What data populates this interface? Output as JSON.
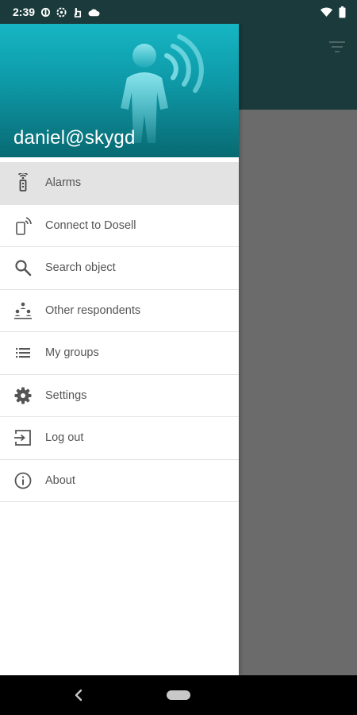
{
  "status_bar": {
    "time": "2:39",
    "left_icons": [
      "sync-icon",
      "settings-badge-icon",
      "touch-icon",
      "cloud-icon"
    ],
    "right_icons": [
      "wifi-icon",
      "battery-icon"
    ]
  },
  "drawer": {
    "account": "daniel@skygd",
    "items": [
      {
        "label": "Alarms",
        "icon": "alarm-icon",
        "active": true
      },
      {
        "label": "Connect to Dosell",
        "icon": "phone-connect-icon"
      },
      {
        "label": "Search object",
        "icon": "search-icon"
      },
      {
        "label": "Other respondents",
        "icon": "respondents-icon"
      },
      {
        "label": "My groups",
        "icon": "list-icon"
      },
      {
        "label": "Settings",
        "icon": "gear-icon"
      },
      {
        "label": "Log out",
        "icon": "logout-icon"
      },
      {
        "label": "About",
        "icon": "info-icon"
      }
    ]
  },
  "colors": {
    "header_top": "#16b6c4",
    "header_bottom": "#086a72",
    "toolbar": "#1a3a3b",
    "scrim": "#6b6b6b",
    "active_item": "#e3e3e3"
  }
}
